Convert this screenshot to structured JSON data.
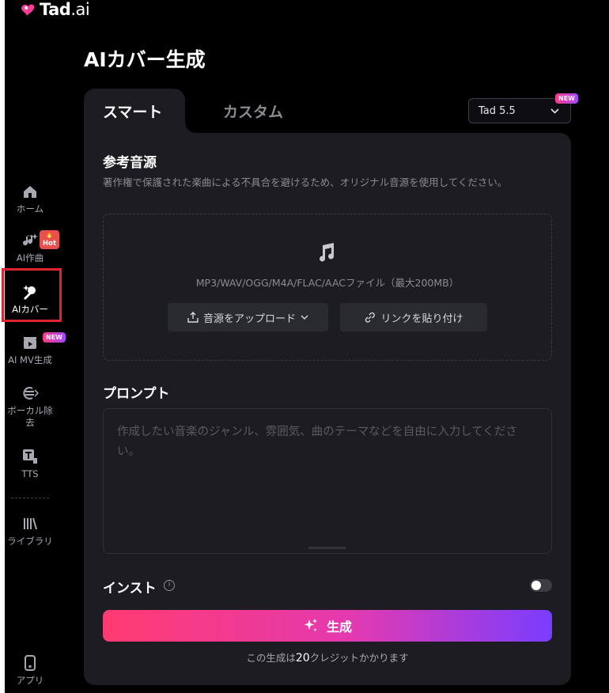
{
  "app": {
    "logo_brand": "Tad",
    "logo_suffix": ".ai"
  },
  "sidebar": {
    "items": [
      {
        "label": "ホーム",
        "icon": "home-icon",
        "badge": ""
      },
      {
        "label": "AI作曲",
        "icon": "music-sparkle-icon",
        "badge": "Hot"
      },
      {
        "label": "AIカバー",
        "icon": "microphone-sparkle-icon",
        "badge": "",
        "active": true
      },
      {
        "label": "AI MV生成",
        "icon": "video-clapper-icon",
        "badge": "NEW"
      },
      {
        "label": "ボーカル除去",
        "icon": "vocal-remove-icon",
        "badge": ""
      },
      {
        "label": "TTS",
        "icon": "tts-icon",
        "badge": ""
      },
      {
        "label": "ライブラリ",
        "icon": "library-icon",
        "badge": ""
      },
      {
        "label": "アプリ",
        "icon": "mobile-app-icon",
        "badge": ""
      }
    ]
  },
  "page": {
    "title": "AIカバー生成"
  },
  "tabs": [
    {
      "label": "スマート",
      "active": true
    },
    {
      "label": "カスタム",
      "active": false
    }
  ],
  "model": {
    "selected": "Tad 5.5",
    "badge": "NEW"
  },
  "reference": {
    "title": "参考音源",
    "description": "著作権で保護された楽曲による不具合を避けるため、オリジナル音源を使用してください。",
    "formats": "MP3/WAV/OGG/M4A/FLAC/AACファイル（最大200MB）",
    "upload_label": "音源をアップロード",
    "link_label": "リンクを貼り付け"
  },
  "prompt": {
    "title": "プロンプト",
    "placeholder": "作成したい音楽のジャンル、雰囲気、曲のテーマなどを自由に入力してください。"
  },
  "instrumental": {
    "label": "インスト",
    "enabled": false
  },
  "generate": {
    "label": "生成",
    "note_prefix": "この生成は",
    "credits": "20",
    "note_suffix": "クレジットかかります"
  },
  "colors": {
    "accent_start": "#ff3a70",
    "accent_end": "#7a3dff",
    "panel_bg": "#1c1c22",
    "highlight": "#e0242c"
  }
}
